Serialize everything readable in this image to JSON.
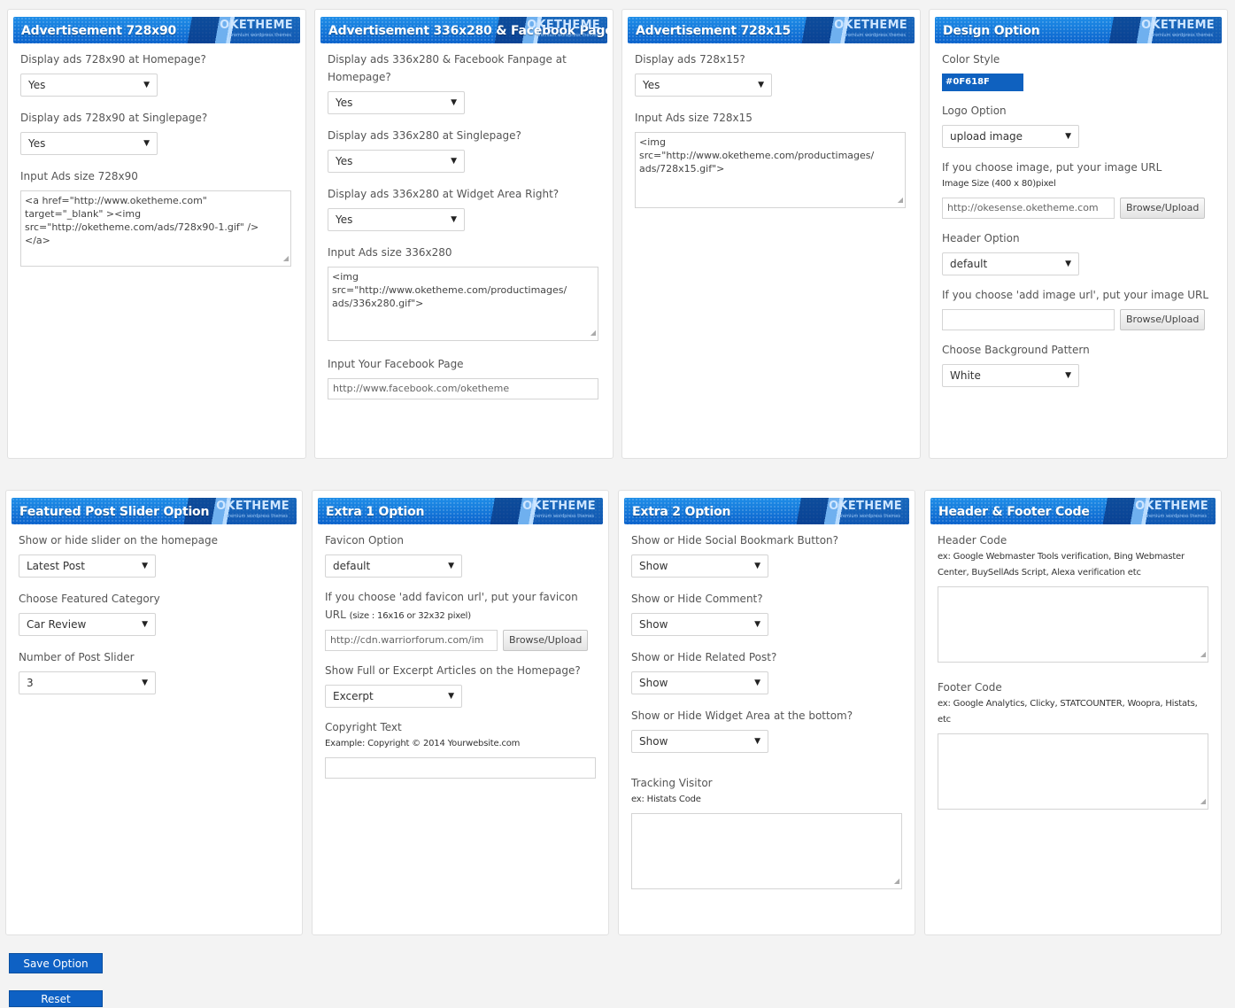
{
  "brand": {
    "name": "OKETHEME",
    "tagline": "premium wordpress themes",
    "accent": "#0b63cc"
  },
  "panels": {
    "ad728": {
      "title": "Advertisement 728x90",
      "home_label": "Display ads 728x90 at Homepage?",
      "home_value": "Yes",
      "single_label": "Display ads 728x90 at Singlepage?",
      "single_value": "Yes",
      "code_label": "Input Ads size 728x90",
      "code_value": "<a href=\"http://www.oketheme.com\"\ntarget=\"_blank\" ><img\nsrc=\"http://oketheme.com/ads/728x90-1.gif\" />\n</a>"
    },
    "ad336": {
      "title": "Advertisement 336x280 & Facebook Page",
      "home_label": "Display ads 336x280 & Facebook Fanpage at Homepage?",
      "home_value": "Yes",
      "single_label": "Display ads 336x280 at Singlepage?",
      "single_value": "Yes",
      "widget_label": "Display ads 336x280 at Widget Area Right?",
      "widget_value": "Yes",
      "code_label": "Input Ads size 336x280",
      "code_value": "<img\nsrc=\"http://www.oketheme.com/productimages/\nads/336x280.gif\">",
      "fb_label": "Input Your Facebook Page",
      "fb_value": "http://www.facebook.com/oketheme"
    },
    "ad72815": {
      "title": "Advertisement 728x15",
      "show_label": "Display ads 728x15?",
      "show_value": "Yes",
      "code_label": "Input Ads size 728x15",
      "code_value": "<img\nsrc=\"http://www.oketheme.com/productimages/\nads/728x15.gif\">"
    },
    "design": {
      "title": "Design Option",
      "color_label": "Color Style",
      "color_value": "#0F618F",
      "logo_label": "Logo Option",
      "logo_value": "upload image",
      "image_label": "If you choose image, put your image URL",
      "image_hint": "Image Size (400 x 80)pixel",
      "image_value": "http://okesense.oketheme.com",
      "browse_label": "Browse/Upload",
      "header_label": "Header Option",
      "header_value": "default",
      "header_image_label": "If you choose 'add image url', put your image URL",
      "header_image_value": "",
      "bg_label": "Choose Background Pattern",
      "bg_value": "White"
    },
    "slider": {
      "title": "Featured Post Slider Option",
      "show_label": "Show or hide slider on the homepage",
      "show_value": "Latest Post",
      "category_label": "Choose Featured Category",
      "category_value": "Car Review",
      "number_label": "Number of Post Slider",
      "number_value": "3"
    },
    "extra1": {
      "title": "Extra 1 Option",
      "favicon_label": "Favicon Option",
      "favicon_value": "default",
      "favicon_url_label": "If you choose 'add favicon url', put your favicon",
      "favicon_url_label2": "URL",
      "favicon_hint": "(size : 16x16 or 32x32 pixel)",
      "favicon_url_value": "http://cdn.warriorforum.com/im",
      "browse_label": "Browse/Upload",
      "excerpt_label": "Show Full or Excerpt Articles on the Homepage?",
      "excerpt_value": "Excerpt",
      "copyright_label": "Copyright Text",
      "copyright_hint": "Example: Copyright © 2014 Yourwebsite.com",
      "copyright_value": ""
    },
    "extra2": {
      "title": "Extra 2 Option",
      "social_label": "Show or Hide Social Bookmark Button?",
      "social_value": "Show",
      "comment_label": "Show or Hide Comment?",
      "comment_value": "Show",
      "related_label": "Show or Hide Related Post?",
      "related_value": "Show",
      "widget_label": "Show or Hide Widget Area at the bottom?",
      "widget_value": "Show",
      "tracking_label": "Tracking Visitor",
      "tracking_hint": "ex: Histats Code",
      "tracking_value": ""
    },
    "headfoot": {
      "title": "Header & Footer Code",
      "header_label": "Header Code",
      "header_hint": "ex: Google Webmaster Tools verification, Bing Webmaster Center, BuySellAds Script, Alexa verification etc",
      "header_value": "",
      "footer_label": "Footer Code",
      "footer_hint": "ex: Google Analytics, Clicky, STATCOUNTER, Woopra, Histats, etc",
      "footer_value": ""
    }
  },
  "actions": {
    "save_label": "Save Option",
    "reset_label": "Reset"
  }
}
